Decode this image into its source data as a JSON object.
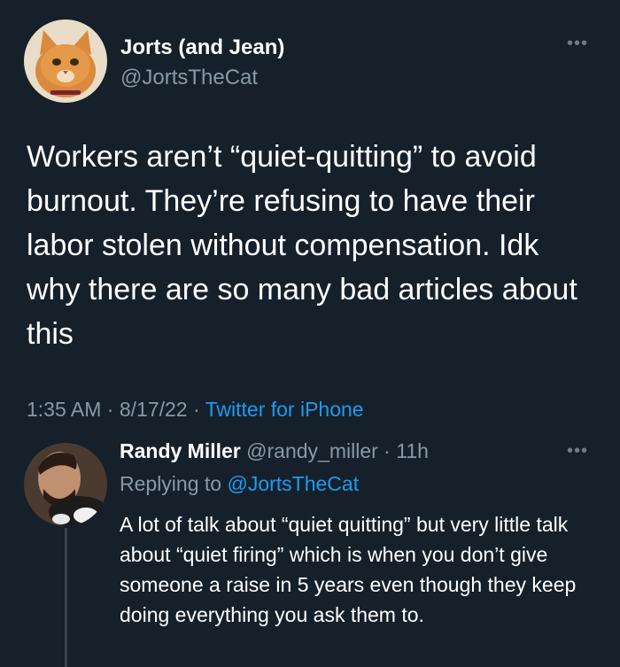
{
  "tweet": {
    "author_name": "Jorts (and Jean)",
    "author_handle": "@JortsTheCat",
    "text": "Workers aren’t “quiet-quitting” to avoid burnout. They’re refusing to have their labor stolen without compensation. Idk why there are so many bad articles about this",
    "time": "1:35 AM",
    "date": "8/17/22",
    "source": "Twitter for iPhone",
    "more_icon": "more-horizontal-icon"
  },
  "reply": {
    "author_name": "Randy Miller",
    "author_handle": "@randy_miller",
    "age": "11h",
    "replying_prefix": "Replying to",
    "replying_to": "@JortsTheCat",
    "text": "A lot of talk about “quiet quitting” but very little talk about “quiet firing” which is when you don’t give someone a raise in 5 years even though they keep doing everything you ask them to.",
    "more_icon": "more-horizontal-icon"
  },
  "colors": {
    "background": "#15202b",
    "text": "#ffffff",
    "secondary": "#8899a6",
    "link": "#1d9bf0"
  }
}
